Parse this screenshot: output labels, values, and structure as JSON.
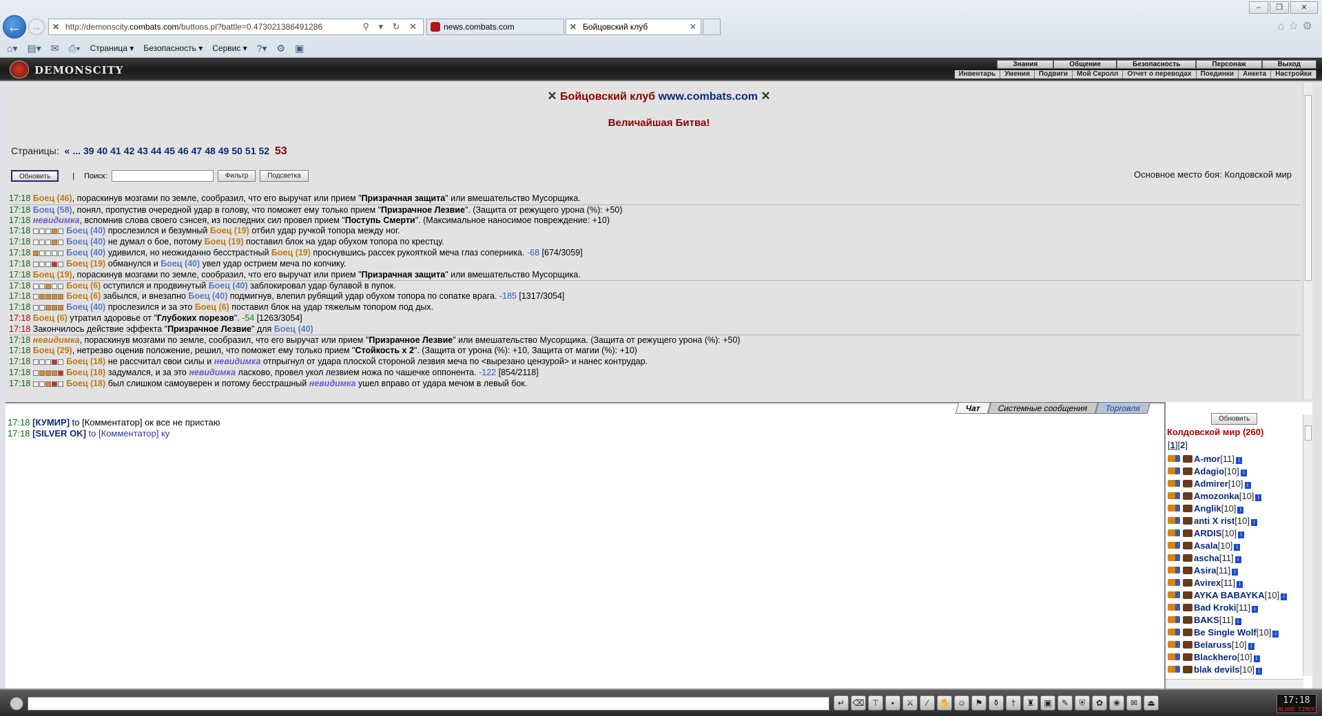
{
  "browser": {
    "url_prefix": "http://demonscity.",
    "url_domain": "combats.com",
    "url_rest": "/buttons.pl?battle=0.473021386491286",
    "addr_tools": "⚲ ▾ ↻ ✕",
    "tabs": [
      {
        "title": "news.combats.com"
      },
      {
        "title": "Бойцовский клуб"
      }
    ],
    "command_bar": [
      "Страница ▾",
      "Безопасность ▾",
      "Сервис ▾"
    ]
  },
  "game": {
    "logo": "DEMONSCITY",
    "top_menu": [
      "Знания",
      "Общение",
      "Безопасность",
      "Персонаж",
      "Выход"
    ],
    "sub_menu": [
      "Инвентарь",
      "Умения",
      "Подвиги",
      "Мой Скролл",
      "Отчет о переводах",
      "Поединки",
      "Анкета",
      "Настройки"
    ]
  },
  "battle": {
    "title_prefix": "Бойцовский клуб ",
    "title_site": "www.combats.com",
    "subtitle": "Величайшая Битва!",
    "pages_label": "Страницы:",
    "pages": [
      "«",
      "...",
      "39",
      "40",
      "41",
      "42",
      "43",
      "44",
      "45",
      "46",
      "47",
      "48",
      "49",
      "50",
      "51",
      "52"
    ],
    "current_page": "53",
    "refresh_label": "Обновить",
    "sep": "|",
    "search_label": "Поиск:",
    "filter_label": "Фильтр",
    "highlight_label": "Подсветка",
    "place": "Основное место боя: Колдовской мир",
    "log": [
      {
        "time": "17:18",
        "html": "<span class='b46'>Боец (46)</span>, пораскинув мозгами по земле, сообразил, что его выручат или прием \"<span class='blk'>Призрачная защита</span>\" или вмешательство Мусорщика."
      },
      {
        "time": "17:18",
        "br": true,
        "html": "<span class='b58'>Боец (58)</span>, понял, пропустив очередной удар в голову, что поможет ему только прием \"<span class='blk'>Призрачное Лезвие</span>\". (Защита от режущего урона (%): +50)"
      },
      {
        "time": "17:18",
        "html": "<span class='inv'>невидимка</span>, вспомнив слова своего сэнсея, из последних сил провел прием \"<span class='blk'>Поступь Смерти</span>\". (Максимальное наносимое повреждение: +10)"
      },
      {
        "time": "17:18",
        "sq": "00010",
        "html": "<span class='b40'>Боец (40)</span> прослезился и безумный <span class='b19'>Боец (19)</span> отбил удар ручкой топора между ног."
      },
      {
        "time": "17:18",
        "sq": "00010",
        "html": "<span class='b40'>Боец (40)</span> не думал о бое, потому <span class='b19'>Боец (19)</span> поставил блок на удар обухом топора по крестцу."
      },
      {
        "time": "17:18",
        "sq": "10000",
        "html": "<span class='b40'>Боец (40)</span> удивился, но неожиданно бесстрастный <span class='b19'>Боец (19)</span> проснувшись рассек рукояткой меча глаз соперника. <span class='dmg'>-68</span> [674/3059]"
      },
      {
        "time": "17:18",
        "sq": "00020",
        "html": "<span class='b19'>Боец (19)</span> обманулся и <span class='b40'>Боец (40)</span> увел удар острием меча по копчику."
      },
      {
        "time": "17:18",
        "html": "<span class='b19'>Боец (19)</span>, пораскинув мозгами по земле, сообразил, что его выручат или прием \"<span class='blk'>Призрачная защита</span>\" или вмешательство Мусорщика."
      },
      {
        "time": "17:18",
        "br": true,
        "sq": "00100",
        "html": "<span class='b6r'>Боец (6)</span> оступился и продвинутый <span class='b40'>Боец (40)</span> заблокировал удар булавой в пупок."
      },
      {
        "time": "17:18",
        "sq": "01111",
        "html": "<span class='b6r'>Боец (6)</span> забылся, и внезапно <span class='b40'>Боец (40)</span> подмигнув, влепил рубящий удар обухом топора по сопатке врага. <span class='dmg'>-185</span> [1317/3054]"
      },
      {
        "time": "17:18",
        "sq": "00111",
        "html": "<span class='b40'>Боец (40)</span> прослезился и за это <span class='b6r'>Боец (6)</span> поставил блок на удар тяжелым топором под дых."
      },
      {
        "time": "17:18",
        "red": true,
        "html": "<span class='b6r'>Боец (6)</span> утратил здоровье от \"<span class='blk'>Глубоких порезов</span>\". <span class='heal'>-54</span> [1263/3054]"
      },
      {
        "time": "17:18",
        "red": true,
        "html": "Закончилось действие эффекта \"<span class='blk'>Призрачное Лезвие</span>\" для <span class='b40'>Боец (40)</span>"
      },
      {
        "time": "17:18",
        "br": true,
        "html": "<span class='inv2'>невидимка</span>, пораскинув мозгами по земле, сообразил, что его выручат или прием \"<span class='blk'>Призрачное Лезвие</span>\" или вмешательство Мусорщика. (Защита от режущего урона (%): +50)"
      },
      {
        "time": "17:18",
        "html": "<span class='b29'>Боец (29)</span>, нетрезво оценив положение, решил, что поможет ему только прием \"<span class='blk'>Стойкость x 2</span>\". (Защита от урона (%): +10, Защита от магии (%): +10)"
      },
      {
        "time": "17:18",
        "sq": "00020",
        "html": "<span class='b19'>Боец (18)</span> не рассчитал свои силы и <span class='inv'>невидимка</span> отпрыгнул от удара плоской стороной лезвия меча по &lt;вырезано цензурой&gt; и нанес контрудар."
      },
      {
        "time": "17:18",
        "sq": "01112",
        "html": "<span class='b19'>Боец (18)</span> задумался, и за это <span class='inv'>невидимка</span> ласково, провел укол лезвием ножа по чашечке оппонента. <span class='dmg'>-122</span> [854/2118]"
      },
      {
        "time": "17:18",
        "sq": "00120",
        "html": "<span class='b19'>Боец (18)</span> был слишком самоуверен и потому бесстрашный <span class='inv'>невидимка</span> ушел вправо от удара мечом в левый бок."
      }
    ]
  },
  "chat": {
    "tabs": [
      "Чат",
      "Системные сообщения",
      "Торговля"
    ],
    "messages": [
      {
        "time": "17:18",
        "nick": "[КУМИР]",
        "text": " to [Комментатор] ок все не пристаю",
        "priv": false
      },
      {
        "time": "17:18",
        "nick": "[SILVER OK]",
        "text": " to [Комментатор] ку",
        "priv": true
      }
    ]
  },
  "users": {
    "refresh_label": "Обновить",
    "location": "Колдовской мир (260)",
    "pages": [
      "[",
      "1",
      "][",
      "2",
      "]"
    ],
    "list": [
      {
        "name": "A-mor",
        "level": "[11]"
      },
      {
        "name": "Adagio",
        "level": "[10]"
      },
      {
        "name": "Admirer",
        "level": "[10]"
      },
      {
        "name": "Amozonka",
        "level": "[10]"
      },
      {
        "name": "Anglik",
        "level": "[10]"
      },
      {
        "name": "anti X rist",
        "level": "[10]"
      },
      {
        "name": "ARDIS",
        "level": "[10]"
      },
      {
        "name": "Asala",
        "level": "[10]"
      },
      {
        "name": "ascha",
        "level": "[11]"
      },
      {
        "name": "Asira",
        "level": "[11]"
      },
      {
        "name": "Avirex",
        "level": "[11]"
      },
      {
        "name": "AYKA BABAYKA",
        "level": "[10]"
      },
      {
        "name": "Bad Kroki",
        "level": "[11]"
      },
      {
        "name": "BAKS",
        "level": "[11]"
      },
      {
        "name": "Be Single Wolf",
        "level": "[10]"
      },
      {
        "name": "Belaruss",
        "level": "[10]"
      },
      {
        "name": "Blackhero",
        "level": "[10]"
      },
      {
        "name": "blak devils",
        "level": "[10]"
      }
    ]
  },
  "clock": {
    "time": "17:18",
    "label": "BLOOD TIMER"
  }
}
